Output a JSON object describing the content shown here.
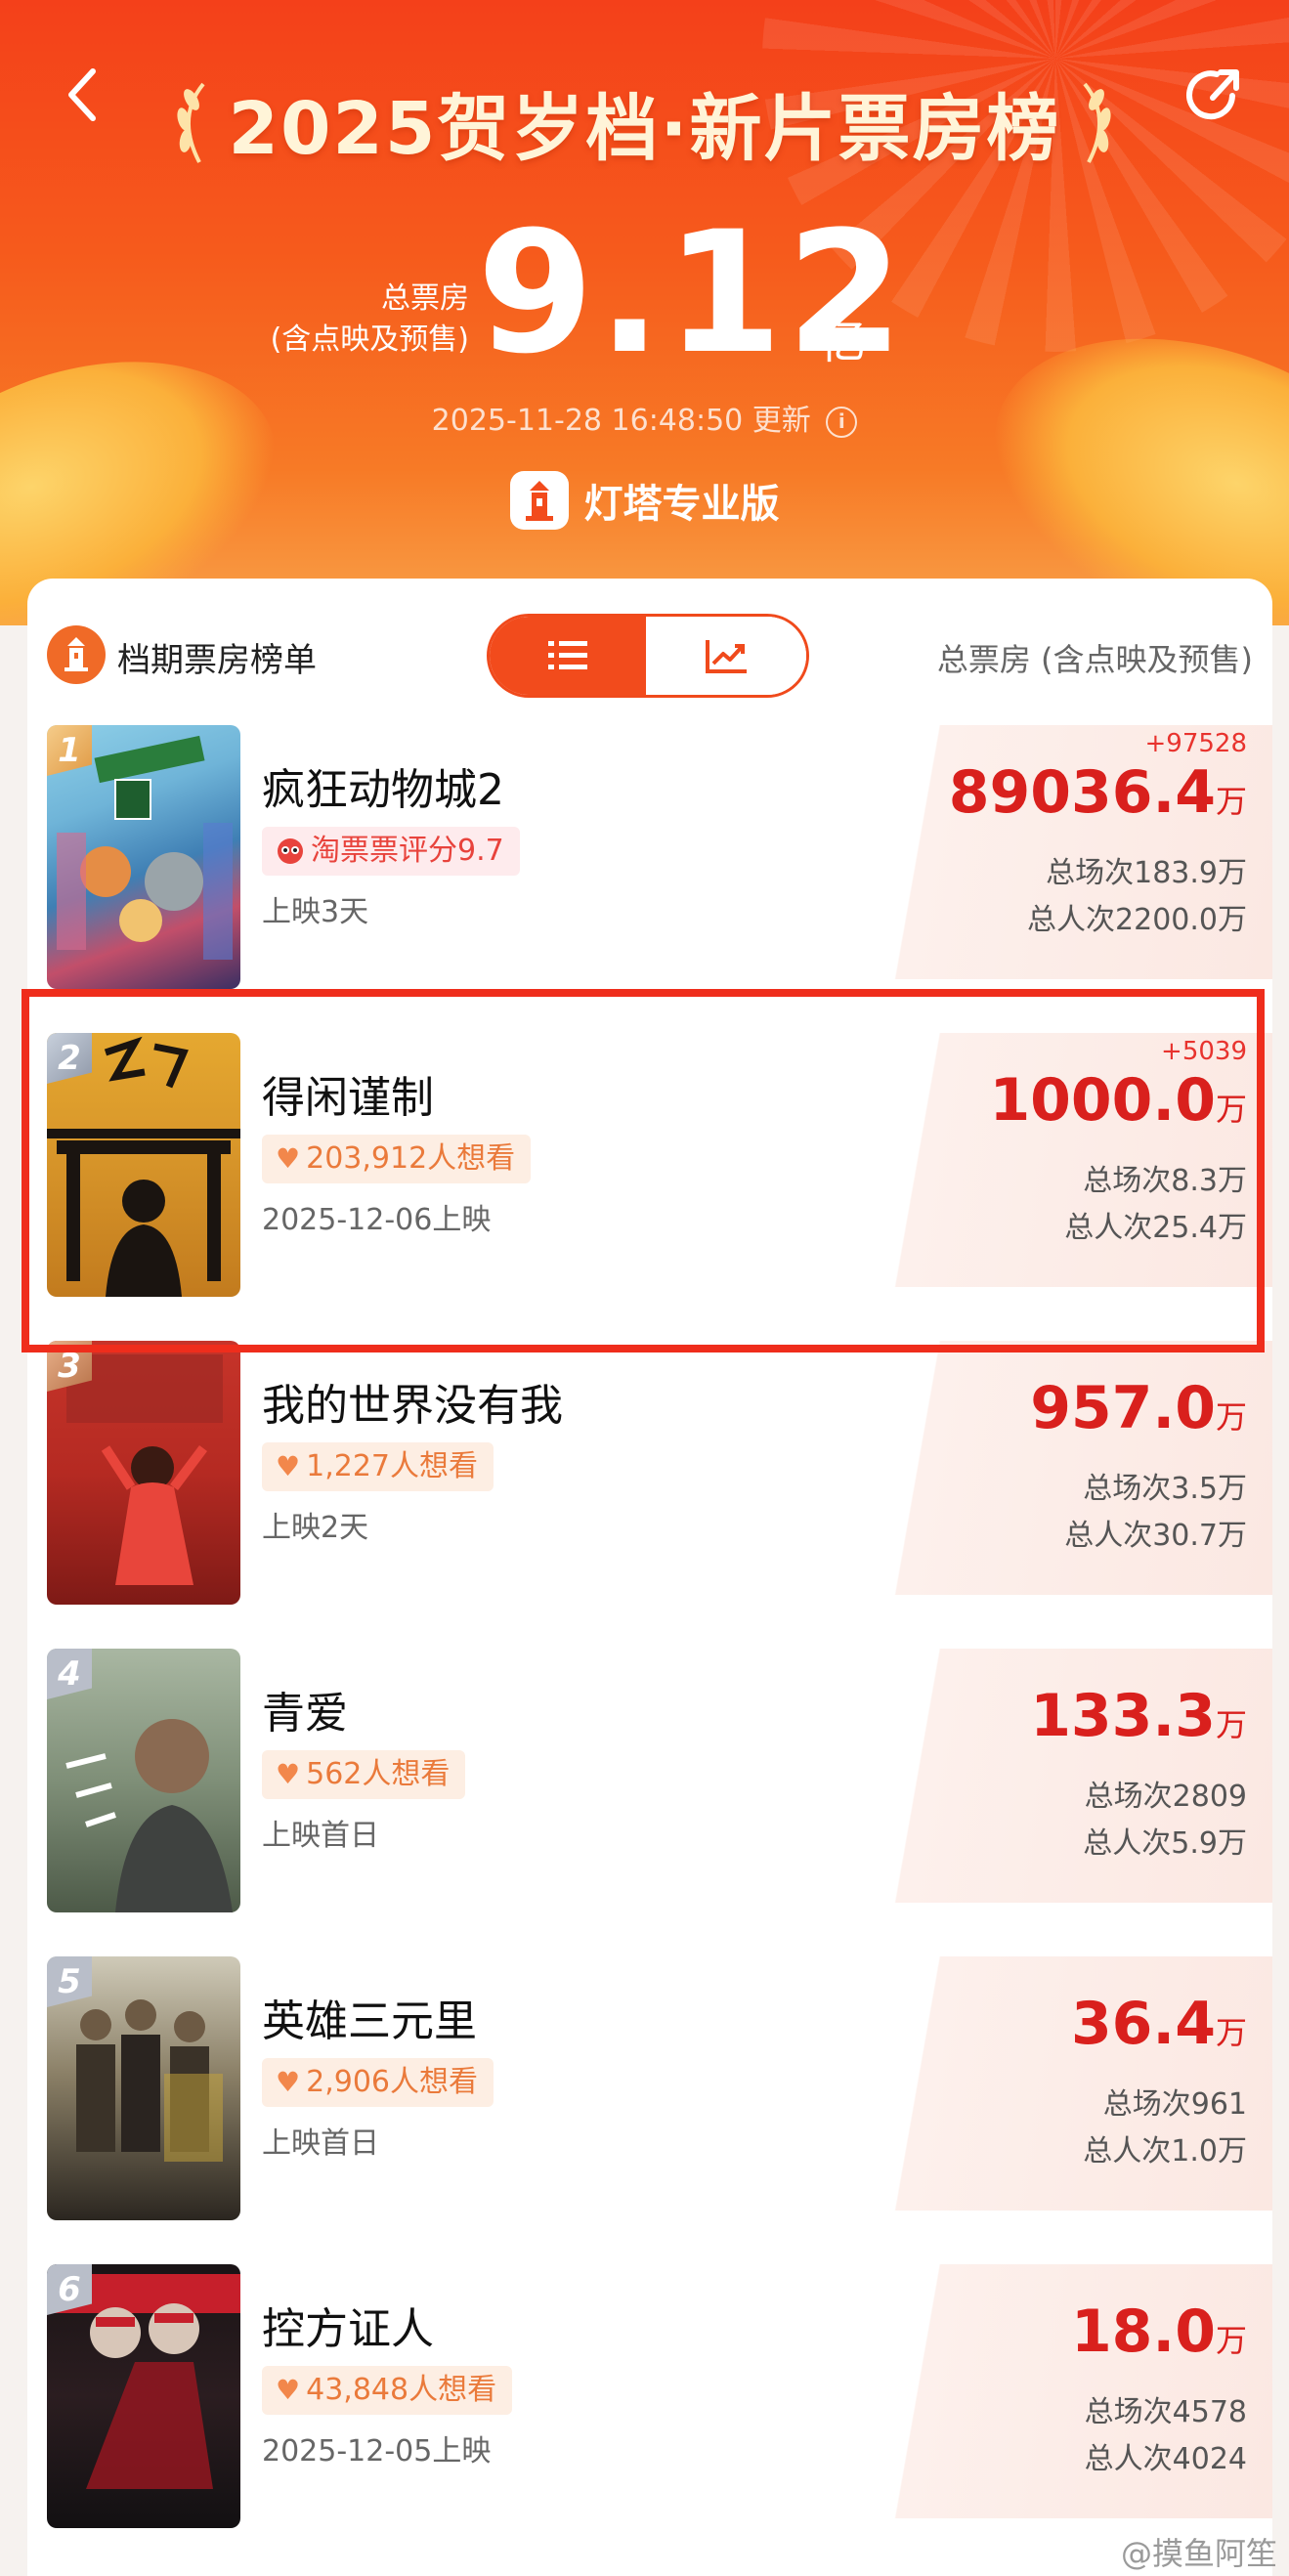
{
  "header": {
    "title": "2025贺岁档·新片票房榜",
    "total_label_line1": "总票房",
    "total_label_line2": "(含点映及预售)",
    "total_value": "9.12",
    "total_unit": "亿",
    "update_time": "2025-11-28 16:48:50 更新",
    "brand": "灯塔专业版"
  },
  "list": {
    "title": "档期票房榜单",
    "column_label": "总票房 (含点映及预售)",
    "view_modes": [
      "list",
      "trend"
    ],
    "active_view": "list"
  },
  "movies": [
    {
      "rank": "1",
      "name": "疯狂动物城2",
      "tag": "淘票票评分9.7",
      "tag_type": "rating",
      "sub": "上映3天",
      "delta": "+97528",
      "box_office": "89036.4",
      "box_unit": "万",
      "screenings": "总场次183.9万",
      "admissions": "总人次2200.0万"
    },
    {
      "rank": "2",
      "name": "得闲谨制",
      "tag": "203,912人想看",
      "tag_type": "want",
      "sub": "2025-12-06上映",
      "delta": "+5039",
      "box_office": "1000.0",
      "box_unit": "万",
      "screenings": "总场次8.3万",
      "admissions": "总人次25.4万"
    },
    {
      "rank": "3",
      "name": "我的世界没有我",
      "tag": "1,227人想看",
      "tag_type": "want",
      "sub": "上映2天",
      "delta": "",
      "box_office": "957.0",
      "box_unit": "万",
      "screenings": "总场次3.5万",
      "admissions": "总人次30.7万"
    },
    {
      "rank": "4",
      "name": "青爱",
      "tag": "562人想看",
      "tag_type": "want",
      "sub": "上映首日",
      "delta": "",
      "box_office": "133.3",
      "box_unit": "万",
      "screenings": "总场次2809",
      "admissions": "总人次5.9万"
    },
    {
      "rank": "5",
      "name": "英雄三元里",
      "tag": "2,906人想看",
      "tag_type": "want",
      "sub": "上映首日",
      "delta": "",
      "box_office": "36.4",
      "box_unit": "万",
      "screenings": "总场次961",
      "admissions": "总人次1.0万"
    },
    {
      "rank": "6",
      "name": "控方证人",
      "tag": "43,848人想看",
      "tag_type": "want",
      "sub": "2025-12-05上映",
      "delta": "",
      "box_office": "18.0",
      "box_unit": "万",
      "screenings": "总场次4578",
      "admissions": "总人次4024"
    }
  ],
  "watermark": "@摸鱼阿笙",
  "colors": {
    "accent": "#f24b1c",
    "box_office_red": "#d9201d",
    "highlight_border": "#ef2d1c"
  }
}
